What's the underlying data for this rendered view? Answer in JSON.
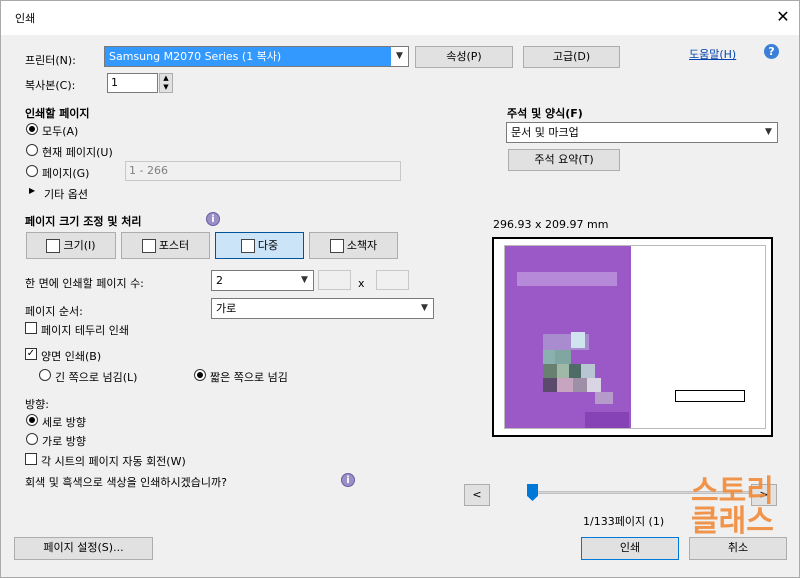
{
  "window": {
    "title": "인쇄",
    "close": "✕"
  },
  "printer": {
    "label": "프린터(N):",
    "selected": "Samsung M2070 Series (1 복사)",
    "properties": "속성(P)",
    "advanced": "고급(D)",
    "help": "도움말(H)"
  },
  "copies": {
    "label": "복사본(C):",
    "value": "1"
  },
  "pages_to_print": {
    "heading": "인쇄할 페이지",
    "all": "모두(A)",
    "current": "현재 페이지(U)",
    "pages": "페이지(G)",
    "pages_placeholder": "1 - 266",
    "more_options": "기타 옵션"
  },
  "comments": {
    "heading": "주석 및 양식(F)",
    "selected": "문서 및 마크업",
    "summarize": "주석 요약(T)"
  },
  "sizing": {
    "heading": "페이지 크기 조정 및 처리",
    "size": "크기(I)",
    "poster": "포스터",
    "multiple": "다중",
    "booklet": "소책자"
  },
  "multiple": {
    "pages_per_sheet_label": "한 면에 인쇄할 페이지 수:",
    "pages_per_sheet": "2",
    "x_sep": "x",
    "order_label": "페이지 순서:",
    "order": "가로",
    "print_border": "페이지 테두리 인쇄"
  },
  "duplex": {
    "label": "양면 인쇄(B)",
    "long_edge": "긴 쪽으로 넘김(L)",
    "short_edge": "짧은 쪽으로 넘김"
  },
  "orientation": {
    "heading": "방향:",
    "portrait": "세로 방향",
    "landscape": "가로 방향",
    "auto_rotate": "각 시트의 페이지 자동 회전(W)"
  },
  "grayscale_question": "회색 및 흑색으로 색상을 인쇄하시겠습니까?",
  "preview": {
    "size": "296.93 x 209.97 mm",
    "page_status": "1/133페이지 (1)",
    "prev": "<",
    "next": ">",
    "slider_position": 0
  },
  "footer": {
    "page_setup": "페이지 설정(S)...",
    "print": "인쇄",
    "cancel": "취소"
  },
  "watermark": "스토리\n클래스",
  "colors": {
    "accent": "#0078d7",
    "purple": "#9b59c8",
    "watermark": "#f08a3a"
  }
}
